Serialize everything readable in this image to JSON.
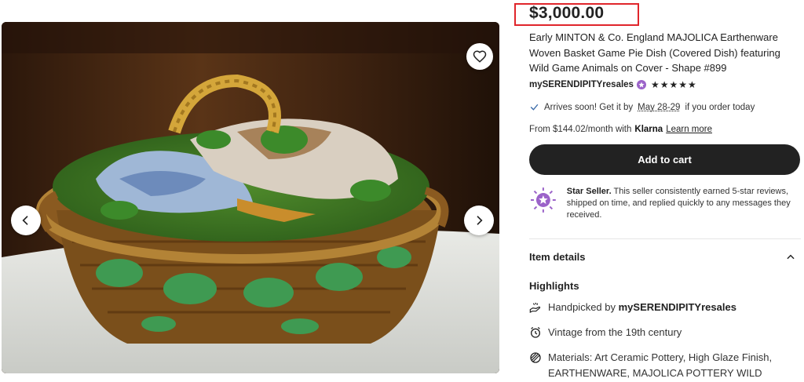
{
  "listing": {
    "price": "$3,000.00",
    "title": "Early MINTON & Co. England MAJOLICA Earthenware Woven Basket Game Pie Dish (Covered Dish) featuring Wild Game Animals on Cover - Shape #899",
    "shop_name": "mySERENDIPITYresales",
    "rating_stars": "★★★★★",
    "rating": 5
  },
  "delivery": {
    "prefix": "Arrives soon! Get it by",
    "dates": "May 28-29",
    "suffix": "if you order today"
  },
  "financing": {
    "prefix": "From $144.02/month with",
    "provider": "Klarna",
    "link": "Learn more"
  },
  "cart": {
    "label": "Add to cart"
  },
  "star_seller": {
    "title": "Star Seller.",
    "text": "This seller consistently earned 5-star reviews, shipped on time, and replied quickly to any messages they received."
  },
  "item_details": {
    "heading": "Item details"
  },
  "highlights": {
    "heading": "Highlights",
    "handpicked_prefix": "Handpicked by",
    "handpicked_shop": "mySERENDIPITYresales",
    "vintage": "Vintage from the 19th century",
    "materials": "Materials: Art Ceramic Pottery, High Glaze Finish, EARTHENWARE, MAJOLICA POTTERY WILD"
  },
  "colors": {
    "price_highlight": "#e0252b",
    "cart_button": "#222222",
    "star_seller_badge": "#9b63c9",
    "check": "#2e7d32"
  },
  "icons": {
    "favorite": "heart-icon",
    "previous": "chevron-left-icon",
    "next": "chevron-right-icon",
    "verified": "star-badge-icon",
    "check": "checkmark-icon",
    "star_seller": "star-seller-badge-icon",
    "collapse": "chevron-up-icon",
    "handpicked": "hand-icon",
    "vintage": "clock-icon",
    "materials": "materials-icon"
  }
}
